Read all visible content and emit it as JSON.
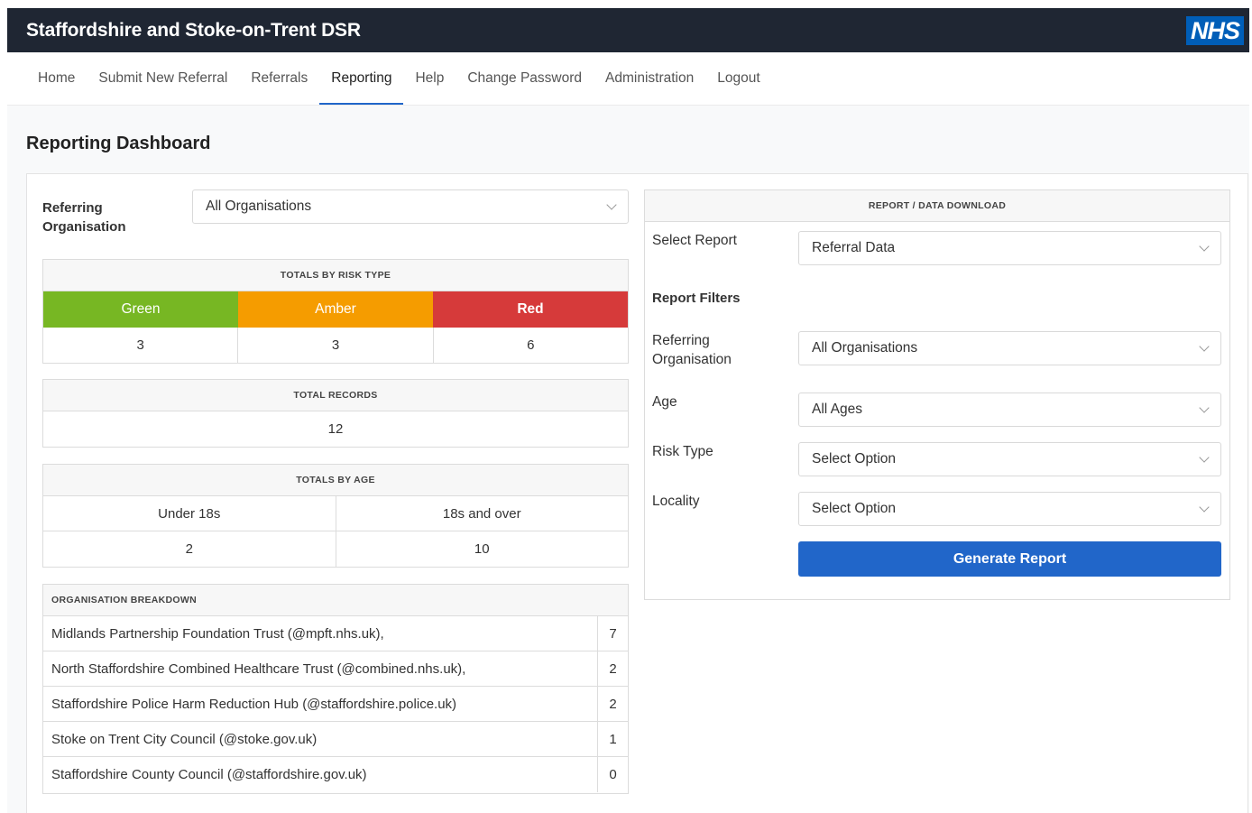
{
  "header": {
    "title": "Staffordshire and Stoke-on-Trent DSR",
    "logo": "NHS"
  },
  "nav": [
    {
      "label": "Home",
      "active": false
    },
    {
      "label": "Submit New Referral",
      "active": false
    },
    {
      "label": "Referrals",
      "active": false
    },
    {
      "label": "Reporting",
      "active": true
    },
    {
      "label": "Help",
      "active": false
    },
    {
      "label": "Change Password",
      "active": false
    },
    {
      "label": "Administration",
      "active": false
    },
    {
      "label": "Logout",
      "active": false
    }
  ],
  "page": {
    "title": "Reporting Dashboard"
  },
  "filter": {
    "label": "Referring Organisation",
    "value": "All Organisations"
  },
  "risk": {
    "title": "TOTALS BY RISK TYPE",
    "types": [
      {
        "label": "Green",
        "value": "3",
        "color": "#77b723"
      },
      {
        "label": "Amber",
        "value": "3",
        "color": "#f59c00"
      },
      {
        "label": "Red",
        "value": "6",
        "color": "#d63a3a"
      }
    ]
  },
  "records": {
    "title": "TOTAL RECORDS",
    "value": "12"
  },
  "age": {
    "title": "TOTALS BY AGE",
    "groups": [
      {
        "label": "Under 18s",
        "value": "2"
      },
      {
        "label": "18s and over",
        "value": "10"
      }
    ]
  },
  "orgs": {
    "title": "ORGANISATION BREAKDOWN",
    "rows": [
      {
        "name": "Midlands Partnership Foundation Trust (@mpft.nhs.uk),",
        "count": "7"
      },
      {
        "name": "North Staffordshire Combined Healthcare Trust (@combined.nhs.uk),",
        "count": "2"
      },
      {
        "name": "Staffordshire Police Harm Reduction Hub (@staffordshire.police.uk)",
        "count": "2"
      },
      {
        "name": "Stoke on Trent City Council (@stoke.gov.uk)",
        "count": "1"
      },
      {
        "name": "Staffordshire County Council (@staffordshire.gov.uk)",
        "count": "0"
      }
    ]
  },
  "report": {
    "title": "REPORT / DATA DOWNLOAD",
    "select_label": "Select Report",
    "select_value": "Referral Data",
    "filters_title": "Report Filters",
    "org_label": "Referring Organisation",
    "org_value": "All Organisations",
    "age_label": "Age",
    "age_value": "All Ages",
    "risk_label": "Risk Type",
    "risk_value": "Select Option",
    "locality_label": "Locality",
    "locality_value": "Select Option",
    "button": "Generate Report"
  }
}
